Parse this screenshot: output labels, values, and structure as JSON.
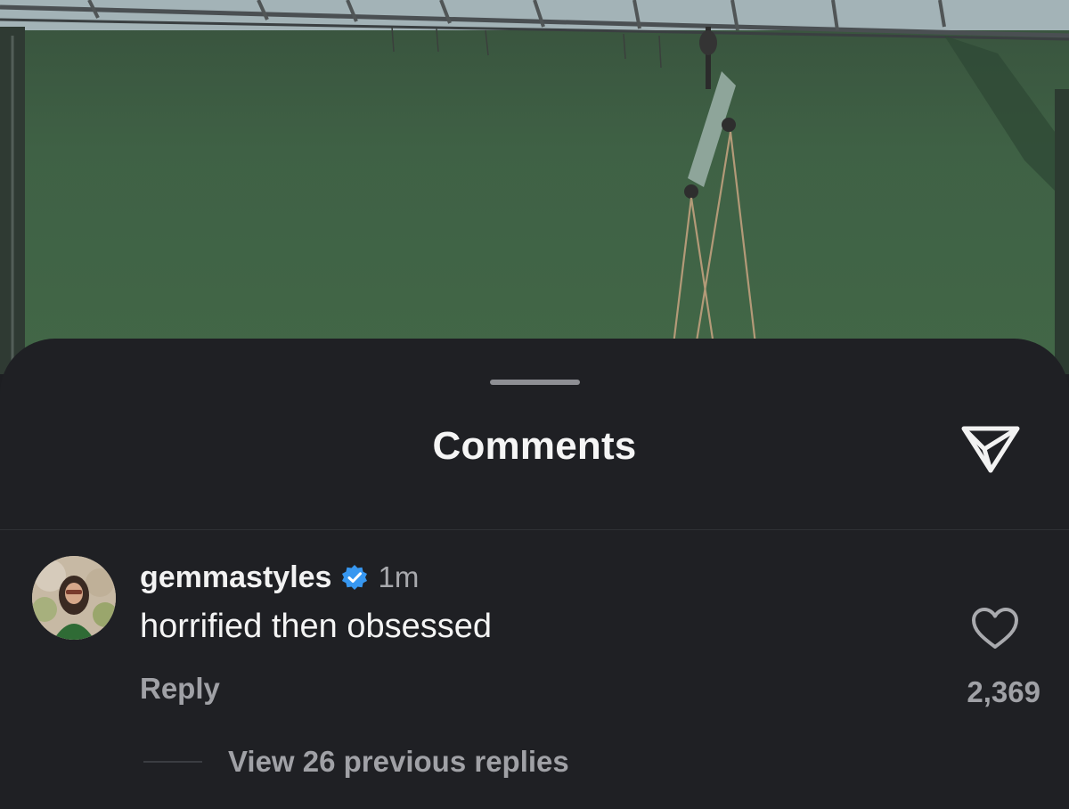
{
  "sheet": {
    "title": "Comments"
  },
  "icons": {
    "share": "paper-plane-icon",
    "verified": "verified-badge-icon",
    "like": "heart-icon",
    "drag": "drag-handle"
  },
  "comment": {
    "username": "gemmastyles",
    "verified": true,
    "time": "1m",
    "text": "horrified then obsessed",
    "reply_label": "Reply",
    "like_count": "2,369",
    "view_replies_label": "View 26 previous replies"
  },
  "colors": {
    "sheet_bg": "#1f2024",
    "text_primary": "#f4f4f4",
    "text_secondary": "#a0a1a6",
    "verified_blue": "#3797f0"
  }
}
